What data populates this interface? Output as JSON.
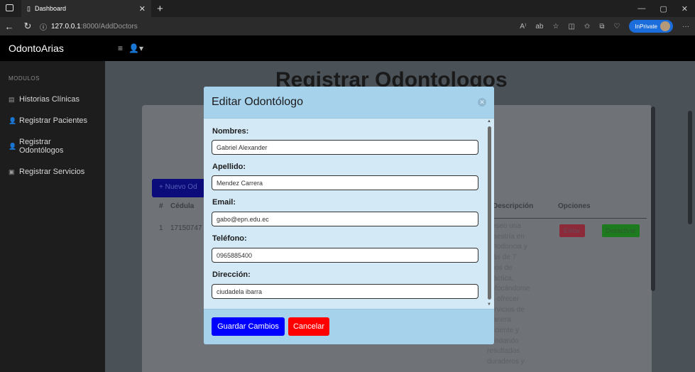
{
  "browser": {
    "tab_title": "Dashboard",
    "url_host": "127.0.0.1",
    "url_path": ":8000/AddDoctors",
    "inprivate_label": "InPrivate"
  },
  "app": {
    "brand": "OdontoArias",
    "sidebar_heading": "MODULOS",
    "sidebar_items": [
      {
        "label": "Historias Clínicas"
      },
      {
        "label": "Registrar Pacientes"
      },
      {
        "label": "Registrar Odontólogos"
      },
      {
        "label": "Registrar Servicios"
      }
    ]
  },
  "page": {
    "title": "Registrar Odontologos",
    "new_button": "+ Nuevo Od",
    "table": {
      "col_num": "#",
      "col_cedula": "Cédula",
      "col_desc": "Descripción",
      "col_options": "Opciones",
      "row_num": "1",
      "row_cedula": "17150747",
      "desc_text": "Poseo una maestría en Ortodoncia y más de 7 años de práctica, enfocándome en ofrecer servicios de manera eficiente y brindando resultados duraderos y",
      "edit_btn": "Editar",
      "deactivate_btn": "Desactivar"
    }
  },
  "modal": {
    "title": "Editar Odontólogo",
    "fields": [
      {
        "label": "Nombres:",
        "value": "Gabriel Alexander"
      },
      {
        "label": "Apellido:",
        "value": "Mendez Carrera"
      },
      {
        "label": "Email:",
        "value": "gabo@epn.edu.ec"
      },
      {
        "label": "Teléfono:",
        "value": "0965885400"
      },
      {
        "label": "Dirección:",
        "value": "ciudadela ibarra"
      }
    ],
    "save_label": "Guardar Cambios",
    "cancel_label": "Cancelar"
  },
  "colors": {
    "save_button": "#0000ff",
    "cancel_button": "#ff0000",
    "modal_header": "#a7d2ec",
    "modal_body": "#d3e9f6"
  }
}
